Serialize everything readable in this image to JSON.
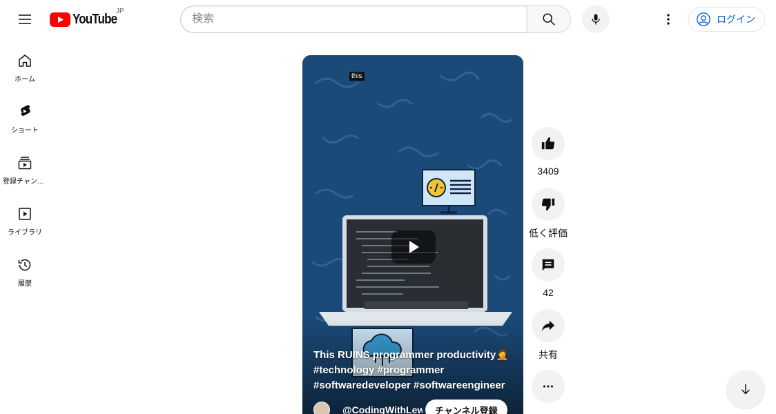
{
  "header": {
    "logo_text": "YouTube",
    "region": "JP",
    "search_placeholder": "検索",
    "login_label": "ログイン"
  },
  "sidebar": {
    "items": [
      {
        "label": "ホーム",
        "icon": "home-icon"
      },
      {
        "label": "ショート",
        "icon": "shorts-icon"
      },
      {
        "label": "登録チャンネル",
        "icon": "subscriptions-icon"
      },
      {
        "label": "ライブラリ",
        "icon": "library-icon"
      },
      {
        "label": "履歴",
        "icon": "history-icon"
      }
    ]
  },
  "player": {
    "caption_tag": "this",
    "title": "This RUINS programmer productivity🤦 #technology #programmer #softwaredeveloper #softwareengineer",
    "channel_name": "@CodingWithLewis",
    "subscribe_label": "チャンネル登録"
  },
  "actions": {
    "like_count": "3409",
    "dislike_label": "低く評価",
    "comment_count": "42",
    "share_label": "共有"
  },
  "colors": {
    "brand_red": "#ff0000",
    "link_blue": "#065fd4",
    "video_bg": "#1b4a78"
  }
}
